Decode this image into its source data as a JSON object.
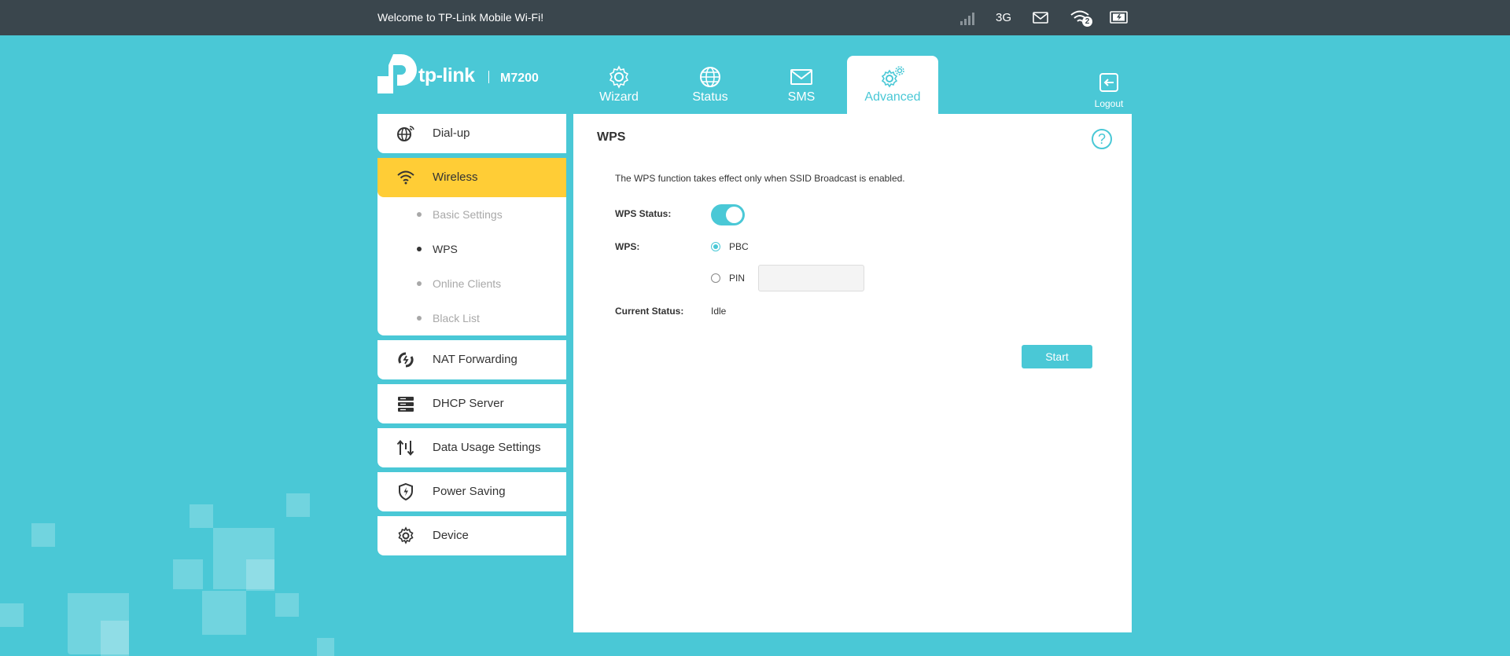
{
  "topbar": {
    "welcome": "Welcome to TP-Link Mobile Wi-Fi!",
    "network_type": "3G",
    "connected_clients": "2",
    "icons": [
      "signal-icon",
      "mail-icon",
      "wifi-icon",
      "battery-charging-icon"
    ]
  },
  "brand": {
    "logo_text": "tp-link",
    "model": "M7200"
  },
  "tabs": [
    {
      "label": "Wizard",
      "icon": "gear-icon"
    },
    {
      "label": "Status",
      "icon": "globe-icon"
    },
    {
      "label": "SMS",
      "icon": "mail-icon"
    },
    {
      "label": "Advanced",
      "icon": "gears-icon",
      "active": true
    }
  ],
  "logout": {
    "label": "Logout"
  },
  "sidebar": {
    "items": [
      {
        "label": "Dial-up",
        "icon": "dialup-globe-icon"
      },
      {
        "label": "Wireless",
        "icon": "wifi-icon",
        "active": true,
        "sub": [
          {
            "label": "Basic Settings"
          },
          {
            "label": "WPS",
            "active": true
          },
          {
            "label": "Online Clients"
          },
          {
            "label": "Black List"
          }
        ]
      },
      {
        "label": "NAT Forwarding",
        "icon": "nat-icon"
      },
      {
        "label": "DHCP Server",
        "icon": "server-icon"
      },
      {
        "label": "Data Usage Settings",
        "icon": "arrows-updown-icon"
      },
      {
        "label": "Power Saving",
        "icon": "shield-bolt-icon"
      },
      {
        "label": "Device",
        "icon": "gear-icon"
      }
    ]
  },
  "main": {
    "title": "WPS",
    "note": "The WPS function takes effect only when SSID Broadcast is enabled.",
    "wps_status_label": "WPS Status:",
    "wps_status_on": true,
    "wps_label": "WPS:",
    "options": [
      {
        "label": "PBC",
        "checked": true
      },
      {
        "label": "PIN",
        "checked": false
      }
    ],
    "pin_value": "",
    "current_status_label": "Current Status:",
    "current_status_value": "Idle",
    "start_label": "Start",
    "help_symbol": "?"
  },
  "colors": {
    "background": "#4ac8d6",
    "topbar": "#3a464d",
    "accent": "#4ac8d6",
    "active_menu": "#ffcd36"
  }
}
